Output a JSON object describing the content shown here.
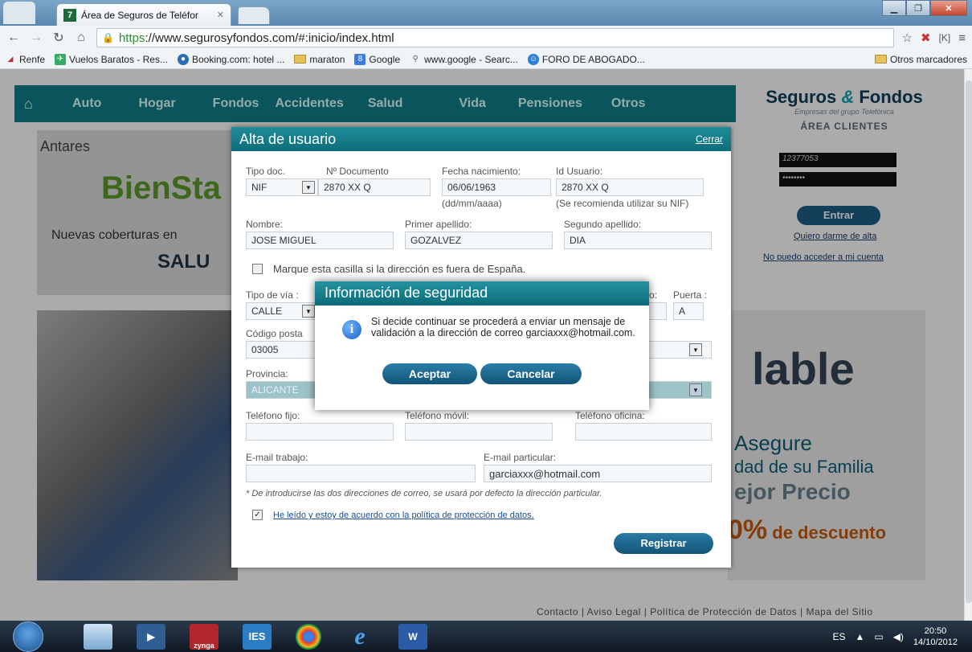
{
  "browser": {
    "tab_title": "Área de Seguros de Teléfor",
    "url_https": "https",
    "url_rest": "://www.segurosyfondos.com/#:inicio/index.html",
    "bookmarks": [
      "Renfe",
      "Vuelos Baratos - Res...",
      "Booking.com: hotel ...",
      "maraton",
      "Google",
      "www.google - Searc...",
      "FORO DE ABOGADO..."
    ],
    "bookmarks_other": "Otros marcadores"
  },
  "site": {
    "nav": [
      "Auto",
      "Hogar",
      "Fondos",
      "Accidentes",
      "Salud",
      "Vida",
      "Pensiones",
      "Otros"
    ],
    "brand_name_1": "Seguros",
    "brand_amp": "&",
    "brand_name_2": "Fondos",
    "brand_sub": "Empresas del grupo Telefónica",
    "area_clientes": "ÁREA CLIENTES",
    "login_user": "12377053",
    "login_pass": "••••••••",
    "entrar": "Entrar",
    "quiero_alta": "Quiero darme de alta",
    "no_puedo": "No puedo acceder a mi cuenta",
    "promo_antares": "Antares",
    "promo_bien": "BienSta",
    "promo_nuevas": "Nuevas coberturas en",
    "promo_salu": "SALU",
    "ad_able": "lable",
    "ad_l1": "Asegure",
    "ad_l2": "dad de su Familia",
    "ad_l3": "ejor Precio",
    "ad_pct": "0%",
    "ad_desc": "de descuento",
    "footer": "Contacto  | Aviso Legal  | Política de Protección de Datos  | Mapa del Sitio"
  },
  "reg_dialog": {
    "title": "Alta de usuario",
    "close": "Cerrar",
    "tipo_doc_label": "Tipo doc.",
    "tipo_doc_value": "NIF",
    "n_doc_label": "Nº Documento",
    "n_doc_value": "2870 XX Q",
    "fecha_label": "Fecha nacimiento:",
    "fecha_value": "06/06/1963",
    "fecha_hint": "(dd/mm/aaaa)",
    "id_label": "Id Usuario:",
    "id_value": "2870 XX Q",
    "id_hint": "(Se recomienda utilizar su NIF)",
    "nombre_label": "Nombre:",
    "nombre_value": "JOSE MIGUEL",
    "ap1_label": "Primer apellido:",
    "ap1_value": "GOZALVEZ",
    "ap2_label": "Segundo apellido:",
    "ap2_value": "DIA",
    "fuera_label": "Marque esta casilla si la dirección es fuera de España.",
    "tipo_via_label": "Tipo de vía :",
    "tipo_via_value": "CALLE",
    "piso_label_tail": "o:",
    "puerta_label": "Puerta :",
    "puerta_value": "A",
    "cp_label": "Código posta",
    "cp_value": "03005",
    "provincia_label": "Provincia:",
    "provincia_value": "ALICANTE",
    "tel_fijo_label": "Teléfono fijo:",
    "tel_movil_label": "Teléfono móvil:",
    "tel_oficina_label": "Teléfono oficina:",
    "email_trabajo_label": "E-mail trabajo:",
    "email_particular_label": "E-mail particular:",
    "email_particular_value": "garciaxxx@hotmail.com",
    "email_note": "* De introducirse las dos direcciones de correo, se usará por defecto la dirección particular.",
    "policy_check": "✓",
    "policy_label": "He leído y estoy de acuerdo con la política de protección de datos.",
    "registrar": "Registrar"
  },
  "info_dialog": {
    "title": "Información de seguridad",
    "message": "Si decide continuar se procederá a enviar un mensaje de validación a la dirección de correo garciaxxx@hotmail.com.",
    "accept": "Aceptar",
    "cancel": "Cancelar"
  },
  "taskbar": {
    "apps": [
      "zynga",
      "IES"
    ],
    "lang": "ES",
    "time": "20:50",
    "date": "14/10/2012"
  }
}
